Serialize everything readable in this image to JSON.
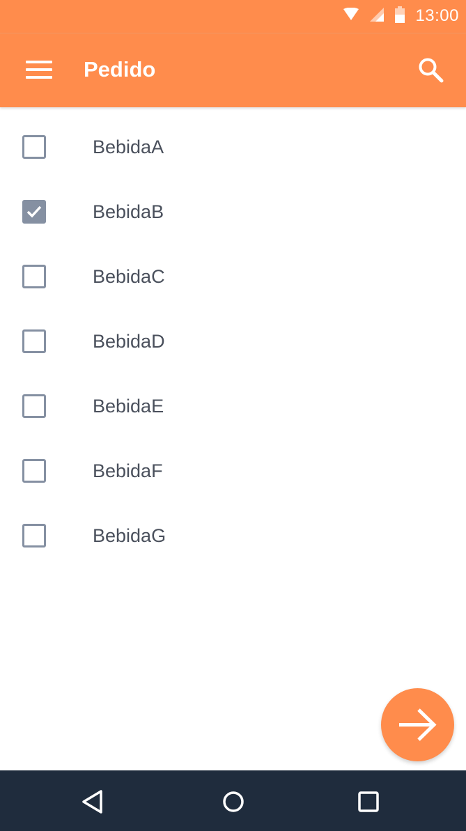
{
  "status_bar": {
    "time": "13:00",
    "icons": [
      "wifi-icon",
      "cell-signal-icon",
      "battery-icon"
    ]
  },
  "app_bar": {
    "title": "Pedido",
    "menu_icon": "menu-icon",
    "search_icon": "search-icon"
  },
  "items": [
    {
      "label": "BebidaA",
      "checked": false
    },
    {
      "label": "BebidaB",
      "checked": true
    },
    {
      "label": "BebidaC",
      "checked": false
    },
    {
      "label": "BebidaD",
      "checked": false
    },
    {
      "label": "BebidaE",
      "checked": false
    },
    {
      "label": "BebidaF",
      "checked": false
    },
    {
      "label": "BebidaG",
      "checked": false
    }
  ],
  "fab": {
    "icon": "arrow-forward-icon"
  },
  "nav_bar": {
    "icons": [
      "back-icon",
      "home-icon",
      "recents-icon"
    ]
  },
  "colors": {
    "primary": "#ff8c4c",
    "checkbox": "#8590a2",
    "text": "#4a505c",
    "nav_bar": "#1f2c3d"
  }
}
